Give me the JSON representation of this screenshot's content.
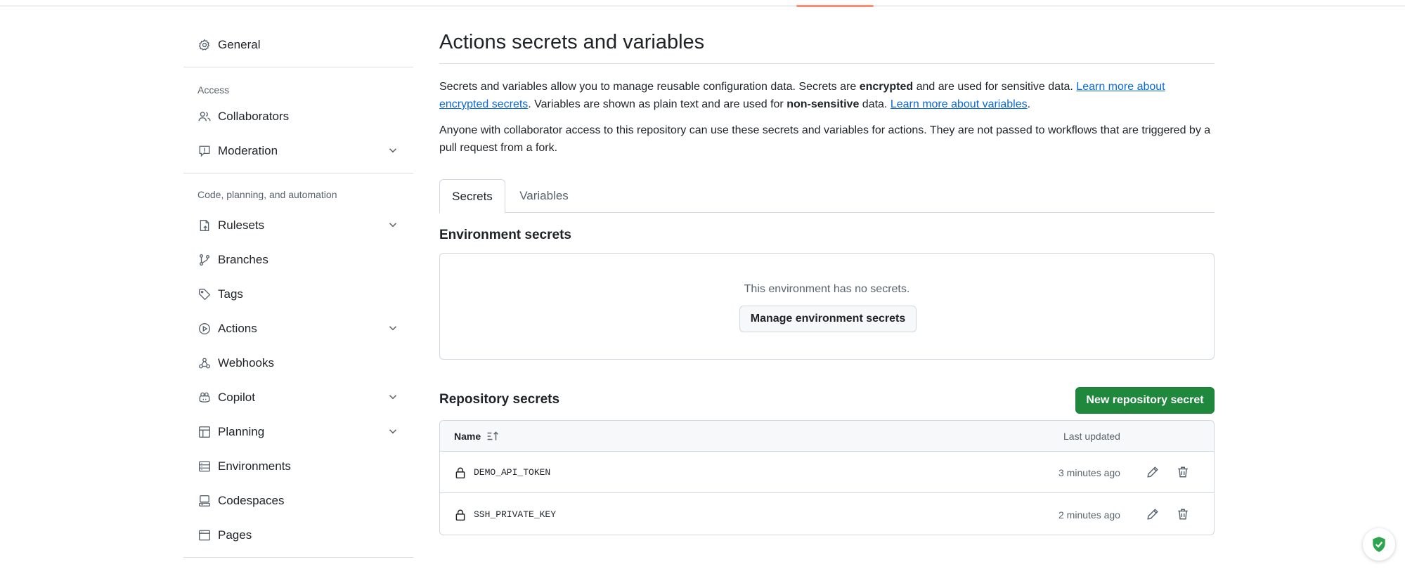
{
  "sidebar": {
    "general": {
      "label": "General",
      "icon": "gear-icon"
    },
    "sections": [
      {
        "heading": "Access",
        "items": [
          {
            "label": "Collaborators",
            "icon": "people-icon",
            "expandable": false
          },
          {
            "label": "Moderation",
            "icon": "report-icon",
            "expandable": true
          }
        ]
      },
      {
        "heading": "Code, planning, and automation",
        "items": [
          {
            "label": "Rulesets",
            "icon": "rulesets-icon",
            "expandable": true
          },
          {
            "label": "Branches",
            "icon": "branch-icon",
            "expandable": false
          },
          {
            "label": "Tags",
            "icon": "tag-icon",
            "expandable": false
          },
          {
            "label": "Actions",
            "icon": "play-icon",
            "expandable": true
          },
          {
            "label": "Webhooks",
            "icon": "webhook-icon",
            "expandable": false
          },
          {
            "label": "Copilot",
            "icon": "copilot-icon",
            "expandable": true
          },
          {
            "label": "Planning",
            "icon": "table-icon",
            "expandable": true
          },
          {
            "label": "Environments",
            "icon": "server-icon",
            "expandable": false
          },
          {
            "label": "Codespaces",
            "icon": "codespaces-icon",
            "expandable": false
          },
          {
            "label": "Pages",
            "icon": "browser-icon",
            "expandable": false
          }
        ]
      }
    ]
  },
  "main": {
    "title": "Actions secrets and variables",
    "intro": {
      "p1": "Secrets and variables allow you to manage reusable configuration data. Secrets are ",
      "bold1": "encrypted",
      "p2": " and are used for sensitive data. ",
      "link1": "Learn more about encrypted secrets",
      "p3": ". Variables are shown as plain text and are used for ",
      "bold2": "non-sensitive",
      "p4": " data. ",
      "link2": "Learn more about variables",
      "p5": "."
    },
    "note": "Anyone with collaborator access to this repository can use these secrets and variables for actions. They are not passed to workflows that are triggered by a pull request from a fork.",
    "tabs": [
      {
        "label": "Secrets",
        "active": true
      },
      {
        "label": "Variables",
        "active": false
      }
    ],
    "environment": {
      "heading": "Environment secrets",
      "empty_text": "This environment has no secrets.",
      "manage_label": "Manage environment secrets"
    },
    "repository": {
      "heading": "Repository secrets",
      "new_label": "New repository secret",
      "columns": {
        "name": "Name",
        "updated": "Last updated"
      },
      "rows": [
        {
          "name": "DEMO_API_TOKEN",
          "updated": "3 minutes ago"
        },
        {
          "name": "SSH_PRIVATE_KEY",
          "updated": "2 minutes ago"
        }
      ]
    }
  },
  "colors": {
    "accent": "#fd8c73",
    "primary_button": "#1f883d",
    "link": "#0969da"
  }
}
